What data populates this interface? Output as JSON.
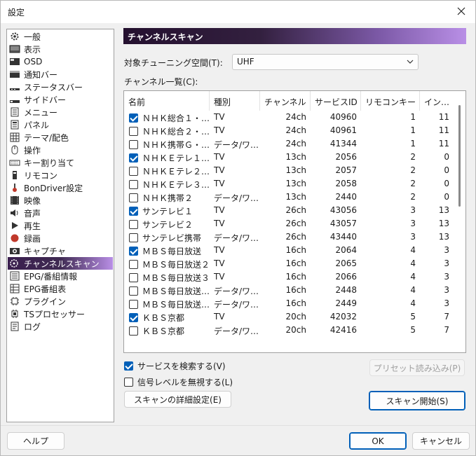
{
  "window": {
    "title": "設定"
  },
  "sidebar": {
    "items": [
      {
        "label": "一般",
        "icon": "gear-icon"
      },
      {
        "label": "表示",
        "icon": "monitor-icon"
      },
      {
        "label": "OSD",
        "icon": "osd-icon"
      },
      {
        "label": "通知バー",
        "icon": "notification-bar-icon"
      },
      {
        "label": "ステータスバー",
        "icon": "status-bar-icon"
      },
      {
        "label": "サイドバー",
        "icon": "side-bar-icon"
      },
      {
        "label": "メニュー",
        "icon": "menu-icon"
      },
      {
        "label": "パネル",
        "icon": "panel-icon"
      },
      {
        "label": "テーマ/配色",
        "icon": "grid-icon"
      },
      {
        "label": "操作",
        "icon": "mouse-icon"
      },
      {
        "label": "キー割り当て",
        "icon": "keyboard-icon"
      },
      {
        "label": "リモコン",
        "icon": "remote-icon"
      },
      {
        "label": "BonDriver設定",
        "icon": "driver-icon"
      },
      {
        "label": "映像",
        "icon": "video-icon"
      },
      {
        "label": "音声",
        "icon": "speaker-icon"
      },
      {
        "label": "再生",
        "icon": "play-icon"
      },
      {
        "label": "録画",
        "icon": "record-icon"
      },
      {
        "label": "キャプチャ",
        "icon": "camera-icon"
      },
      {
        "label": "チャンネルスキャン",
        "icon": "scan-icon"
      },
      {
        "label": "EPG/番組情報",
        "icon": "epg-icon"
      },
      {
        "label": "EPG番組表",
        "icon": "program-guide-icon"
      },
      {
        "label": "プラグイン",
        "icon": "plugin-icon"
      },
      {
        "label": "TSプロセッサー",
        "icon": "processor-icon"
      },
      {
        "label": "ログ",
        "icon": "log-icon"
      }
    ],
    "selected_index": 18
  },
  "panel": {
    "title": "チャンネルスキャン",
    "tuning_space_label": "対象チューニング空間(T):",
    "tuning_space_value": "UHF",
    "channel_list_label": "チャンネル一覧(C):"
  },
  "table": {
    "columns": [
      "名前",
      "種別",
      "チャンネル",
      "サービスID",
      "リモコンキー",
      "イン…"
    ],
    "rows": [
      {
        "checked": true,
        "name": "ＮＨＫ総合１・…",
        "type": "TV",
        "channel": "24ch",
        "service_id": "40960",
        "remote": "1",
        "index": "11"
      },
      {
        "checked": false,
        "name": "ＮＨＫ総合２・…",
        "type": "TV",
        "channel": "24ch",
        "service_id": "40961",
        "remote": "1",
        "index": "11"
      },
      {
        "checked": false,
        "name": "ＮＨＫ携帯Ｇ・…",
        "type": "データ/ワ…",
        "channel": "24ch",
        "service_id": "41344",
        "remote": "1",
        "index": "11"
      },
      {
        "checked": true,
        "name": "ＮＨＫＥテレ１…",
        "type": "TV",
        "channel": "13ch",
        "service_id": "2056",
        "remote": "2",
        "index": "0"
      },
      {
        "checked": false,
        "name": "ＮＨＫＥテレ２…",
        "type": "TV",
        "channel": "13ch",
        "service_id": "2057",
        "remote": "2",
        "index": "0"
      },
      {
        "checked": false,
        "name": "ＮＨＫＥテレ３…",
        "type": "TV",
        "channel": "13ch",
        "service_id": "2058",
        "remote": "2",
        "index": "0"
      },
      {
        "checked": false,
        "name": "ＮＨＫ携帯２",
        "type": "データ/ワ…",
        "channel": "13ch",
        "service_id": "2440",
        "remote": "2",
        "index": "0"
      },
      {
        "checked": true,
        "name": "サンテレビ１",
        "type": "TV",
        "channel": "26ch",
        "service_id": "43056",
        "remote": "3",
        "index": "13"
      },
      {
        "checked": false,
        "name": "サンテレビ２",
        "type": "TV",
        "channel": "26ch",
        "service_id": "43057",
        "remote": "3",
        "index": "13"
      },
      {
        "checked": false,
        "name": "サンテレビ携帯",
        "type": "データ/ワ…",
        "channel": "26ch",
        "service_id": "43440",
        "remote": "3",
        "index": "13"
      },
      {
        "checked": true,
        "name": "ＭＢＳ毎日放送",
        "type": "TV",
        "channel": "16ch",
        "service_id": "2064",
        "remote": "4",
        "index": "3"
      },
      {
        "checked": false,
        "name": "ＭＢＳ毎日放送２",
        "type": "TV",
        "channel": "16ch",
        "service_id": "2065",
        "remote": "4",
        "index": "3"
      },
      {
        "checked": false,
        "name": "ＭＢＳ毎日放送３",
        "type": "TV",
        "channel": "16ch",
        "service_id": "2066",
        "remote": "4",
        "index": "3"
      },
      {
        "checked": false,
        "name": "ＭＢＳ毎日放送…",
        "type": "データ/ワ…",
        "channel": "16ch",
        "service_id": "2448",
        "remote": "4",
        "index": "3"
      },
      {
        "checked": false,
        "name": "ＭＢＳ毎日放送…",
        "type": "データ/ワ…",
        "channel": "16ch",
        "service_id": "2449",
        "remote": "4",
        "index": "3"
      },
      {
        "checked": true,
        "name": "ＫＢＳ京都",
        "type": "TV",
        "channel": "20ch",
        "service_id": "42032",
        "remote": "5",
        "index": "7"
      },
      {
        "checked": false,
        "name": "ＫＢＳ京都",
        "type": "データ/ワ…",
        "channel": "20ch",
        "service_id": "42416",
        "remote": "5",
        "index": "7"
      }
    ]
  },
  "options": {
    "search_services_label": "サービスを検索する(V)",
    "search_services_checked": true,
    "ignore_signal_label": "信号レベルを無視する(L)",
    "ignore_signal_checked": false
  },
  "buttons": {
    "preset_load": "プリセット読み込み(P)",
    "scan_detail": "スキャンの詳細設定(E)",
    "scan_start": "スキャン開始(S)",
    "help": "ヘルプ",
    "ok": "OK",
    "cancel": "キャンセル"
  }
}
